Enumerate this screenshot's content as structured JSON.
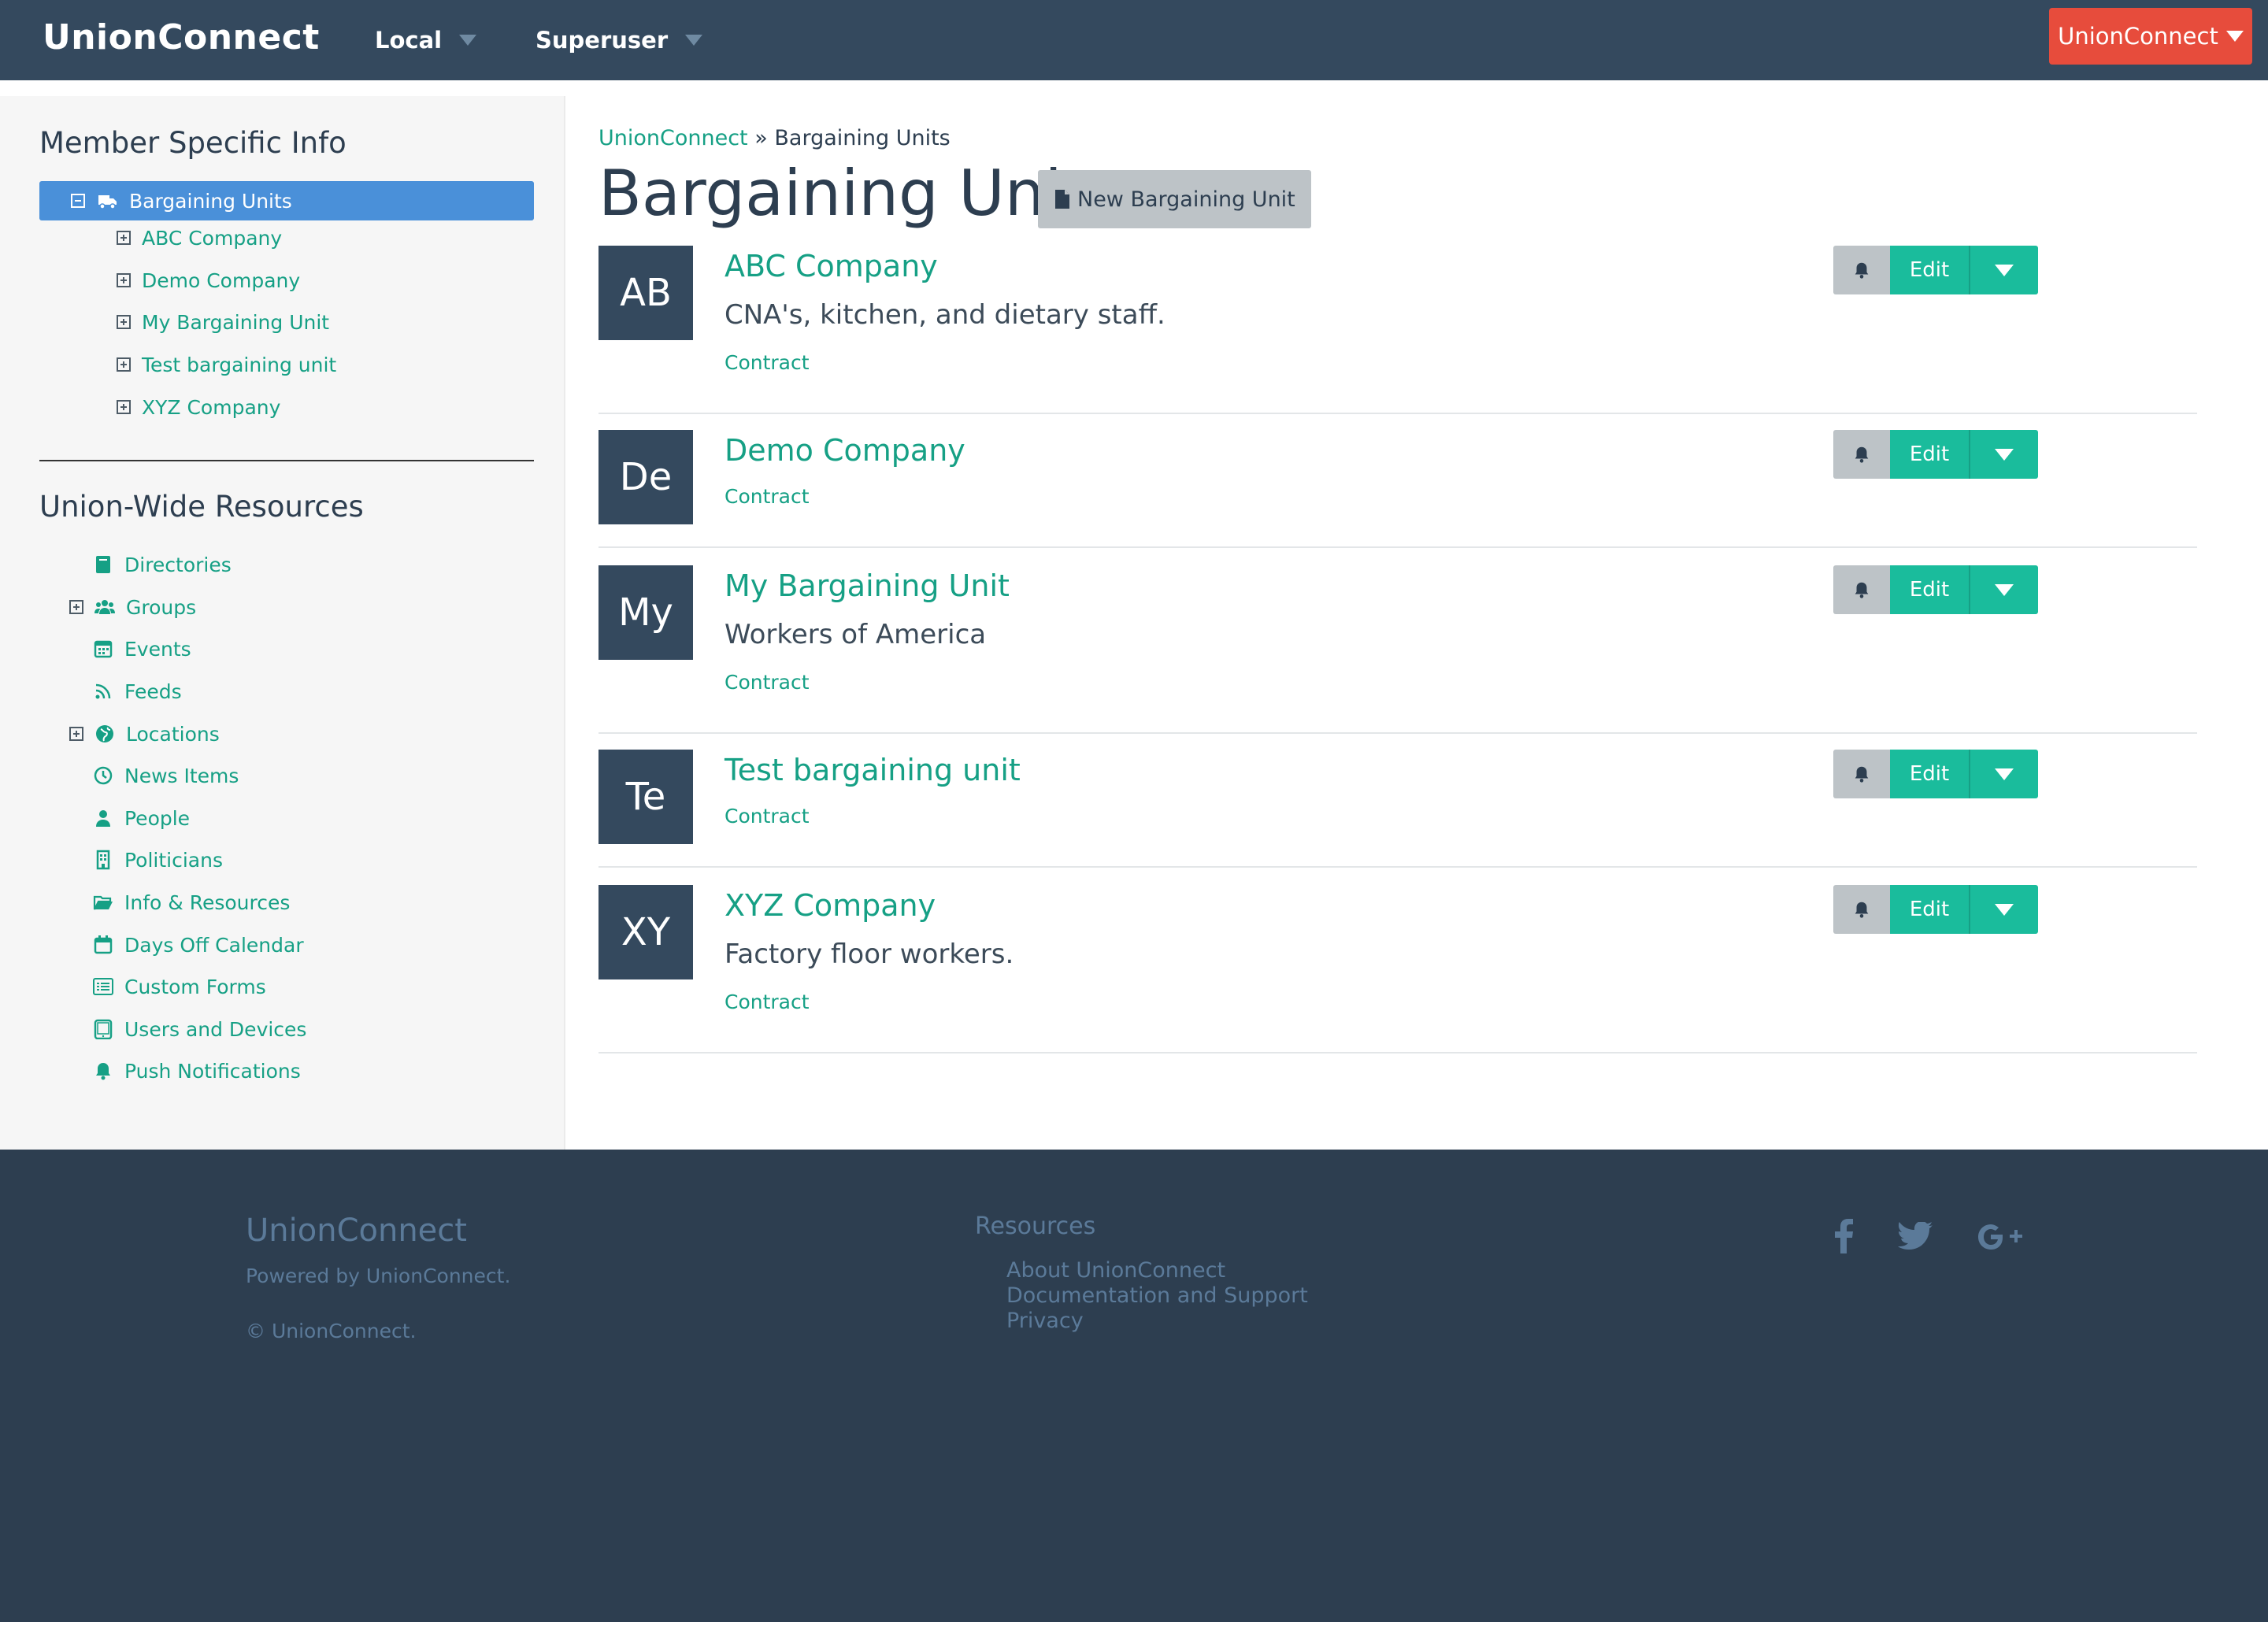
{
  "navbar": {
    "brand": "UnionConnect",
    "menus": [
      {
        "label": "Local"
      },
      {
        "label": "Superuser"
      }
    ],
    "account_button": "UnionConnect"
  },
  "sidebar": {
    "member_heading": "Member Specific Info",
    "member_tree": {
      "active_label": "Bargaining Units",
      "active_icon": "truck-icon",
      "children": [
        {
          "label": "ABC Company"
        },
        {
          "label": "Demo Company"
        },
        {
          "label": "My Bargaining Unit"
        },
        {
          "label": "Test bargaining unit"
        },
        {
          "label": "XYZ Company"
        }
      ]
    },
    "resources_heading": "Union-Wide Resources",
    "resources": [
      {
        "label": "Directories",
        "icon": "book-icon",
        "expandable": false
      },
      {
        "label": "Groups",
        "icon": "users-icon",
        "expandable": true
      },
      {
        "label": "Events",
        "icon": "calendar-grid-icon",
        "expandable": false
      },
      {
        "label": "Feeds",
        "icon": "rss-icon",
        "expandable": false
      },
      {
        "label": "Locations",
        "icon": "globe-icon",
        "expandable": true
      },
      {
        "label": "News Items",
        "icon": "clock-icon",
        "expandable": false
      },
      {
        "label": "People",
        "icon": "user-icon",
        "expandable": false
      },
      {
        "label": "Politicians",
        "icon": "building-icon",
        "expandable": false
      },
      {
        "label": "Info & Resources",
        "icon": "folder-open-icon",
        "expandable": false
      },
      {
        "label": "Days Off Calendar",
        "icon": "calendar-icon",
        "expandable": false
      },
      {
        "label": "Custom Forms",
        "icon": "list-alt-icon",
        "expandable": false
      },
      {
        "label": "Users and Devices",
        "icon": "tablet-icon",
        "expandable": false
      },
      {
        "label": "Push Notifications",
        "icon": "bell-icon",
        "expandable": false
      }
    ]
  },
  "main": {
    "breadcrumb": {
      "root": "UnionConnect",
      "separator": "»",
      "current": "Bargaining Units"
    },
    "title": "Bargaining Units",
    "new_button": "New Bargaining Unit",
    "edit_label": "Edit",
    "units": [
      {
        "initials": "AB",
        "name": "ABC Company",
        "description": "CNA's, kitchen, and dietary staff.",
        "link": "Contract"
      },
      {
        "initials": "De",
        "name": "Demo Company",
        "description": "",
        "link": "Contract"
      },
      {
        "initials": "My",
        "name": "My Bargaining Unit",
        "description": "Workers of America",
        "link": "Contract"
      },
      {
        "initials": "Te",
        "name": "Test bargaining unit",
        "description": "",
        "link": "Contract"
      },
      {
        "initials": "XY",
        "name": "XYZ Company",
        "description": "Factory floor workers.",
        "link": "Contract"
      }
    ]
  },
  "footer": {
    "brand": "UnionConnect",
    "powered_by": "Powered by UnionConnect.",
    "copyright": "© UnionConnect.",
    "resources_heading": "Resources",
    "links": [
      "About UnionConnect",
      "Documentation and Support",
      "Privacy"
    ],
    "social_icons": [
      "facebook-icon",
      "twitter-icon",
      "google-plus-icon"
    ]
  },
  "colors": {
    "navbar": "#34495e",
    "accent": "#16a085",
    "button_green": "#1abc9c",
    "account_red": "#e74c3c",
    "active_blue": "#4a90d9",
    "footer": "#2d3e50"
  }
}
